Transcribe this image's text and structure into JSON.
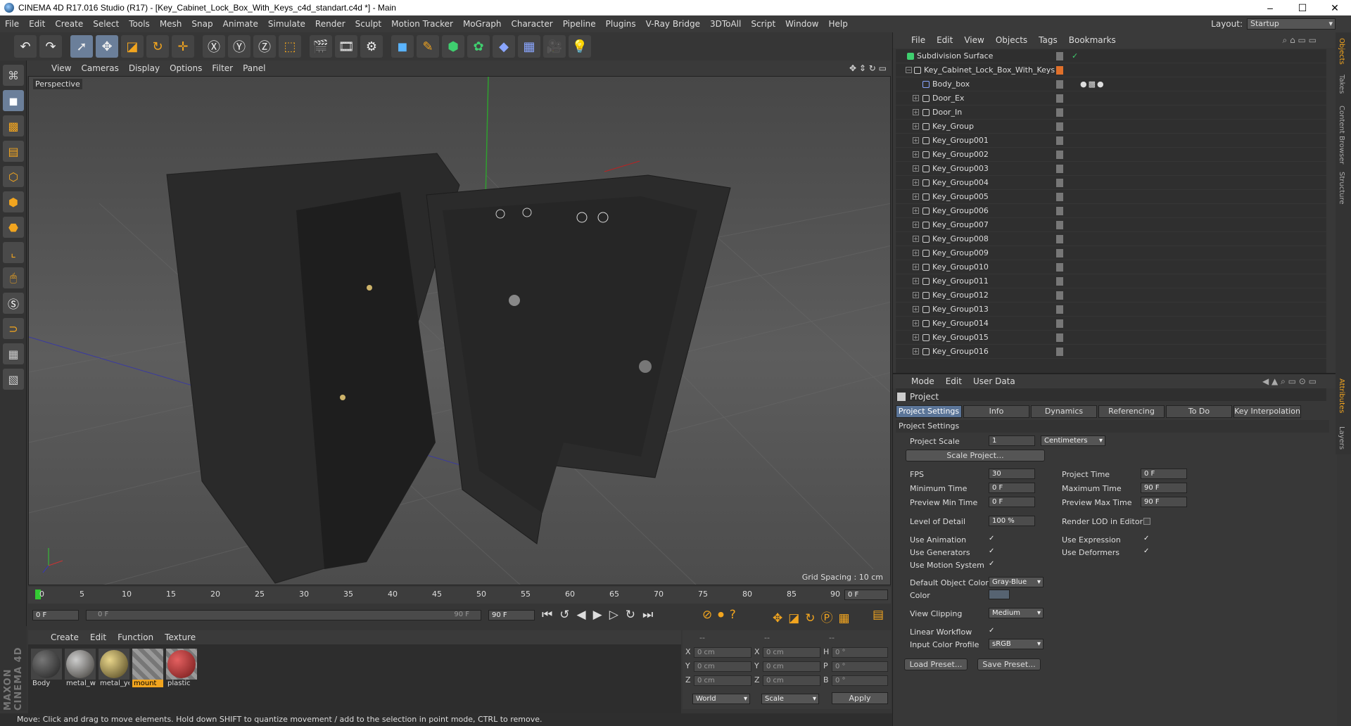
{
  "window": {
    "title": "CINEMA 4D R17.016 Studio (R17) - [Key_Cabinet_Lock_Box_With_Keys_c4d_standart.c4d *] - Main",
    "min": "–",
    "max": "☐",
    "close": "✕"
  },
  "menu": [
    "File",
    "Edit",
    "Create",
    "Select",
    "Tools",
    "Mesh",
    "Snap",
    "Animate",
    "Simulate",
    "Render",
    "Sculpt",
    "Motion Tracker",
    "MoGraph",
    "Character",
    "Pipeline",
    "Plugins",
    "V-Ray Bridge",
    "3DToAll",
    "Script",
    "Window",
    "Help"
  ],
  "layout": {
    "label": "Layout:",
    "value": "Startup"
  },
  "viewport": {
    "menu": [
      "View",
      "Cameras",
      "Display",
      "Options",
      "Filter",
      "Panel"
    ],
    "label": "Perspective",
    "grid_spacing": "Grid Spacing : 10 cm"
  },
  "timeline": {
    "ticks": [
      "0",
      "5",
      "10",
      "15",
      "20",
      "25",
      "30",
      "35",
      "40",
      "45",
      "50",
      "55",
      "60",
      "65",
      "70",
      "75",
      "80",
      "85",
      "90"
    ],
    "end_field": "0 F",
    "start": "0 F",
    "range_start": "0 F",
    "range_end": "90 F",
    "max": "90 F"
  },
  "materials": {
    "menu": [
      "Create",
      "Edit",
      "Function",
      "Texture"
    ],
    "items": [
      {
        "name": "Body",
        "color": "#3a3a3a",
        "selected": false
      },
      {
        "name": "metal_w",
        "color": "#6f6a60",
        "selected": false
      },
      {
        "name": "metal_ye",
        "color": "#8a7a45",
        "selected": false
      },
      {
        "name": "mount",
        "color": "#777777",
        "selected": true
      },
      {
        "name": "plastic",
        "color": "#a83232",
        "selected": false
      }
    ]
  },
  "coords": {
    "headers": [
      "--",
      "--",
      "--"
    ],
    "rows": [
      {
        "a": "X",
        "v1": "0 cm",
        "b": "X",
        "v2": "0 cm",
        "c": "H",
        "v3": "0 °"
      },
      {
        "a": "Y",
        "v1": "0 cm",
        "b": "Y",
        "v2": "0 cm",
        "c": "P",
        "v3": "0 °"
      },
      {
        "a": "Z",
        "v1": "0 cm",
        "b": "Z",
        "v2": "0 cm",
        "c": "B",
        "v3": "0 °"
      }
    ],
    "mode1": "World",
    "mode2": "Scale",
    "apply": "Apply"
  },
  "status": "Move: Click and drag to move elements. Hold down SHIFT to quantize movement / add to the selection in point mode, CTRL to remove.",
  "object_manager": {
    "menu": [
      "File",
      "Edit",
      "View",
      "Objects",
      "Tags",
      "Bookmarks"
    ],
    "objects": [
      {
        "name": "Subdivision Surface",
        "indent": 0
      },
      {
        "name": "Key_Cabinet_Lock_Box_With_Keys",
        "indent": 1
      },
      {
        "name": "Body_box",
        "indent": 2
      },
      {
        "name": "Door_Ex",
        "indent": 2
      },
      {
        "name": "Door_In",
        "indent": 2
      },
      {
        "name": "Key_Group",
        "indent": 2
      },
      {
        "name": "Key_Group001",
        "indent": 2
      },
      {
        "name": "Key_Group002",
        "indent": 2
      },
      {
        "name": "Key_Group003",
        "indent": 2
      },
      {
        "name": "Key_Group004",
        "indent": 2
      },
      {
        "name": "Key_Group005",
        "indent": 2
      },
      {
        "name": "Key_Group006",
        "indent": 2
      },
      {
        "name": "Key_Group007",
        "indent": 2
      },
      {
        "name": "Key_Group008",
        "indent": 2
      },
      {
        "name": "Key_Group009",
        "indent": 2
      },
      {
        "name": "Key_Group010",
        "indent": 2
      },
      {
        "name": "Key_Group011",
        "indent": 2
      },
      {
        "name": "Key_Group012",
        "indent": 2
      },
      {
        "name": "Key_Group013",
        "indent": 2
      },
      {
        "name": "Key_Group014",
        "indent": 2
      },
      {
        "name": "Key_Group015",
        "indent": 2
      },
      {
        "name": "Key_Group016",
        "indent": 2
      }
    ]
  },
  "attributes": {
    "menu": [
      "Mode",
      "Edit",
      "User Data"
    ],
    "title": "Project",
    "tabs": [
      "Project Settings",
      "Info",
      "Dynamics",
      "Referencing",
      "To Do",
      "Key Interpolation"
    ],
    "section": "Project Settings",
    "project_scale_label": "Project Scale",
    "project_scale": "1",
    "project_scale_unit": "Centimeters",
    "scale_project_btn": "Scale Project...",
    "fps_label": "FPS",
    "fps": "30",
    "project_time_label": "Project Time",
    "project_time": "0 F",
    "min_time_label": "Minimum Time",
    "min_time": "0 F",
    "max_time_label": "Maximum Time",
    "max_time": "90 F",
    "prev_min_label": "Preview Min Time",
    "prev_min": "0 F",
    "prev_max_label": "Preview Max Time",
    "prev_max": "90 F",
    "lod_label": "Level of Detail",
    "lod": "100 %",
    "render_lod_label": "Render LOD in Editor",
    "use_anim_label": "Use Animation",
    "use_expr_label": "Use Expression",
    "use_gen_label": "Use Generators",
    "use_def_label": "Use Deformers",
    "use_motion_label": "Use Motion System",
    "def_color_label": "Default Object Color",
    "def_color": "Gray-Blue",
    "color_label": "Color",
    "view_clip_label": "View Clipping",
    "view_clip": "Medium",
    "linear_label": "Linear Workflow",
    "input_profile_label": "Input Color Profile",
    "input_profile": "sRGB",
    "load_preset": "Load Preset...",
    "save_preset": "Save Preset...",
    "check": "✓"
  },
  "side_tabs": [
    "Objects",
    "Takes",
    "Content Browser",
    "Structure",
    "Attributes",
    "Layers"
  ]
}
